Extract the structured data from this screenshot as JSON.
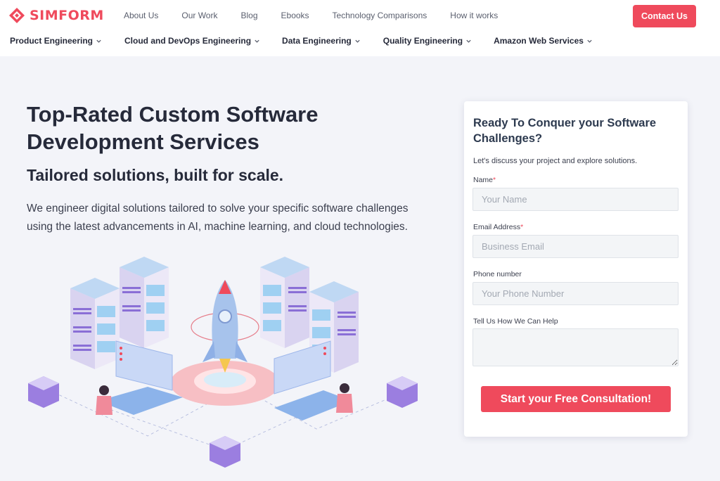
{
  "brand": {
    "name": "SIMFORM",
    "color": "#ef4a5c",
    "logo_icon": "simform-logo-icon"
  },
  "top_nav": [
    {
      "label": "About Us"
    },
    {
      "label": "Our Work"
    },
    {
      "label": "Blog"
    },
    {
      "label": "Ebooks"
    },
    {
      "label": "Technology Comparisons"
    },
    {
      "label": "How it works"
    }
  ],
  "contact_button": {
    "label": "Contact Us"
  },
  "main_nav": [
    {
      "label": "Product Engineering",
      "icon": "chevron-down-icon"
    },
    {
      "label": "Cloud and DevOps Engineering",
      "icon": "chevron-down-icon"
    },
    {
      "label": "Data Engineering",
      "icon": "chevron-down-icon"
    },
    {
      "label": "Quality Engineering",
      "icon": "chevron-down-icon"
    },
    {
      "label": "Amazon Web Services",
      "icon": "chevron-down-icon"
    }
  ],
  "hero": {
    "title_line1": "Top-Rated Custom Software",
    "title_line2": "Development Services",
    "subtitle": "Tailored solutions, built for scale.",
    "description_line1": "We engineer digital solutions tailored to solve your specific software challenges",
    "description_line2": "using the latest advancements in AI, machine learning, and cloud technologies.",
    "illustration_icon": "rocket-servers-illustration"
  },
  "form": {
    "title_line1": "Ready To Conquer your Software",
    "title_line2": "Challenges?",
    "intro": "Let's discuss your project and explore solutions.",
    "name_label": "Name",
    "name_placeholder": "Your Name",
    "email_label": "Email Address",
    "email_placeholder": "Business Email",
    "phone_label": "Phone number",
    "phone_placeholder": "Your Phone Number",
    "help_label": "Tell Us How We Can Help",
    "required_mark": "*",
    "submit_label": "Start your Free Consultation!"
  },
  "colors": {
    "accent": "#ef4a5c",
    "page_bg": "#f3f4f9",
    "text_dark": "#262a3a"
  }
}
